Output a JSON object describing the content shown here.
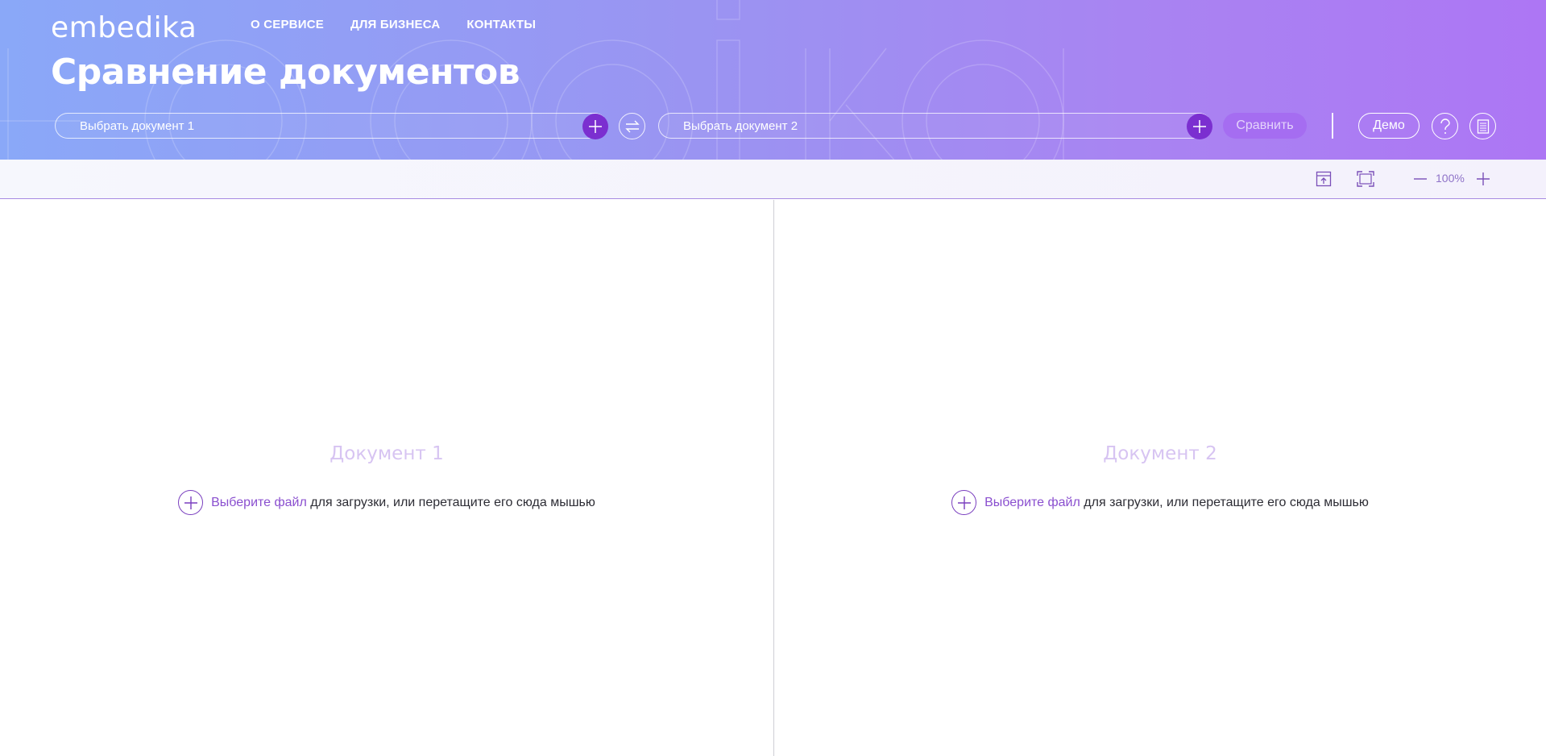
{
  "brand": {
    "logo": "embedika"
  },
  "nav": [
    {
      "label": "О СЕРВИСЕ"
    },
    {
      "label": "ДЛЯ БИЗНЕСА"
    },
    {
      "label": "КОНТАКТЫ"
    }
  ],
  "page": {
    "title": "Сравнение документов"
  },
  "selectors": {
    "doc1_placeholder": "Выбрать документ 1",
    "doc2_placeholder": "Выбрать документ 2",
    "compare_label": "Сравнить",
    "demo_label": "Демо"
  },
  "toolbar": {
    "zoom": "100%"
  },
  "panels": [
    {
      "title": "Документ 1",
      "upload_link": "Выберите файл",
      "upload_text": "для загрузки, или перетащите его сюда мышью"
    },
    {
      "title": "Документ 2",
      "upload_link": "Выберите файл",
      "upload_text": "для загрузки, или перетащите его сюда мышью"
    }
  ],
  "colors": {
    "header_start": "#8aa8f8",
    "header_end": "#ad76f4",
    "accent": "#7b2fd0",
    "link": "#8a4fcf"
  },
  "icons": [
    "plus-icon",
    "swap-icon",
    "help-icon",
    "document-icon",
    "export-icon",
    "fullscreen-icon",
    "zoom-out-icon",
    "zoom-in-icon"
  ]
}
